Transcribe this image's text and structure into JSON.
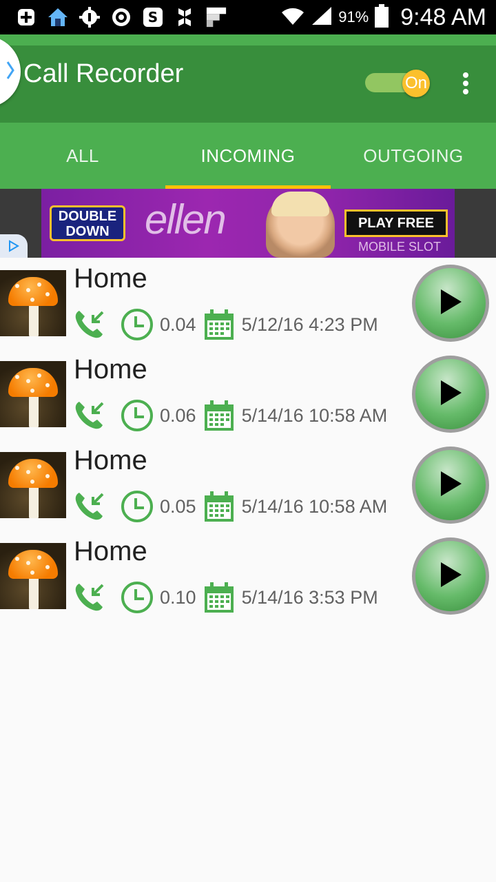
{
  "status_bar": {
    "battery_percent": "91%",
    "time": "9:48 AM",
    "left_icons": [
      "plus-box-icon",
      "home-icon",
      "gear-number-icon",
      "at-icon",
      "dollar-icon",
      "hootsuite-icon",
      "flipboard-icon"
    ]
  },
  "toolbar": {
    "title": "Call Recorder",
    "toggle_label": "On",
    "toggle_on": true,
    "background": "#388e3c",
    "accent": "#4caf50"
  },
  "tabs": [
    {
      "label": "ALL",
      "active": false
    },
    {
      "label": "INCOMING",
      "active": true
    },
    {
      "label": "OUTGOING",
      "active": false
    }
  ],
  "ad": {
    "logo_text": "DOUBLE DOWN",
    "brand": "ellen",
    "cta": "PLAY FREE",
    "subtitle": "MOBILE SLOT"
  },
  "recordings": [
    {
      "name": "Home",
      "duration": "0.04",
      "datetime": "5/12/16 4:23 PM",
      "direction": "incoming"
    },
    {
      "name": "Home",
      "duration": "0.06",
      "datetime": "5/14/16 10:58 AM",
      "direction": "incoming"
    },
    {
      "name": "Home",
      "duration": "0.05",
      "datetime": "5/14/16 10:58 AM",
      "direction": "incoming"
    },
    {
      "name": "Home",
      "duration": "0.10",
      "datetime": "5/14/16 3:53 PM",
      "direction": "incoming"
    }
  ],
  "colors": {
    "icon_green": "#4caf50",
    "tab_indicator": "#ffc107"
  }
}
